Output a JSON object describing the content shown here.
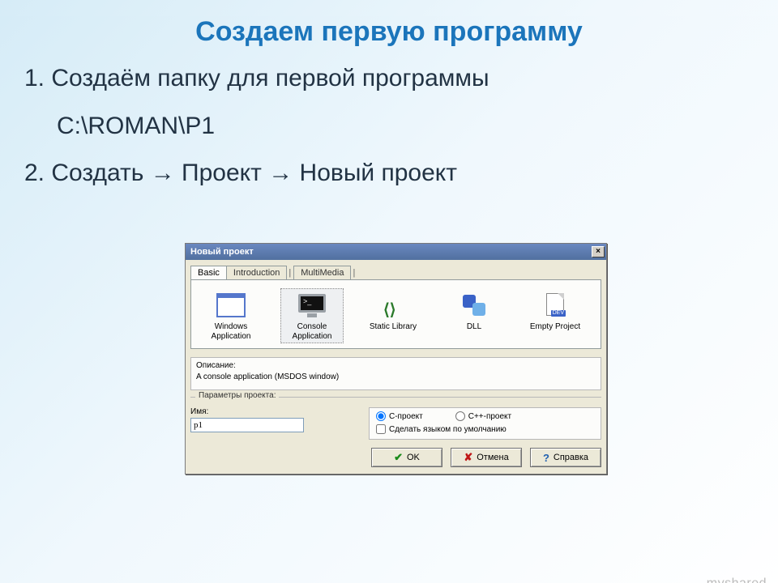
{
  "slide": {
    "title": "Создаем первую программу",
    "line1": "1. Создаём папку для первой программы",
    "path": "C:\\ROMAN\\P1",
    "line2before": "2. Создать ",
    "arrow": "→",
    "line2mid": " Проект ",
    "line2after": " Новый проект",
    "watermark": "myshared"
  },
  "dialog": {
    "title": "Новый проект",
    "close_glyph": "×",
    "tabs": {
      "basic": "Basic",
      "intro": "Introduction",
      "multi": "MultiMedia"
    },
    "templates": {
      "win": "Windows Application",
      "con": "Console Application",
      "lib": "Static Library",
      "dll": "DLL",
      "empty": "Empty Project"
    },
    "desc_label": "Описание:",
    "desc_text": "A console application (MSDOS window)",
    "params_legend": "Параметры проекта:",
    "name_label": "Имя:",
    "name_value": "p1",
    "radio_c": "C-проект",
    "radio_cpp": "C++-проект",
    "chk_default": "Сделать языком по умолчанию",
    "buttons": {
      "ok": "OK",
      "cancel": "Отмена",
      "help": "Справка"
    }
  }
}
